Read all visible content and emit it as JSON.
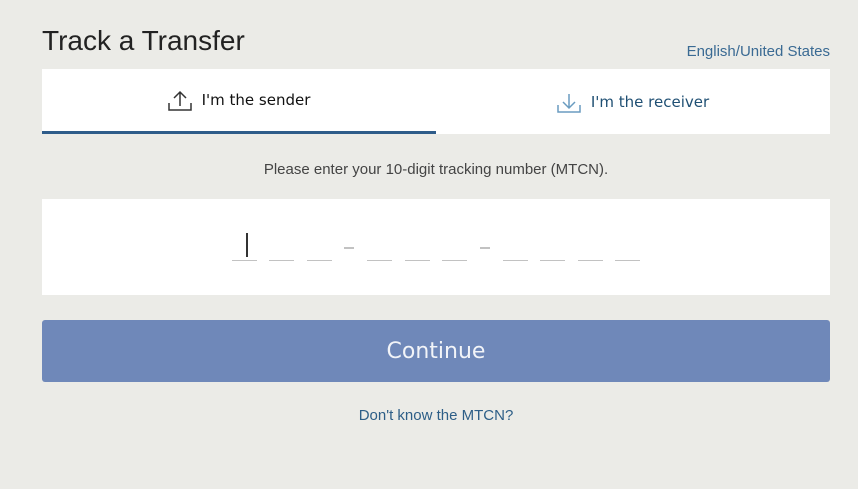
{
  "header": {
    "title": "Track a Transfer",
    "language_link": "English/United States"
  },
  "tabs": [
    {
      "label": "I'm the sender",
      "icon": "upload-icon",
      "active": true
    },
    {
      "label": "I'm the receiver",
      "icon": "download-icon",
      "active": false
    }
  ],
  "form": {
    "instruction": "Please enter your 10-digit tracking number (MTCN).",
    "mtcn_value": "",
    "digit_count": 10,
    "continue_label": "Continue",
    "help_link": "Don't know the MTCN?"
  },
  "colors": {
    "background": "#ebebe7",
    "accent": "#2e5c8a",
    "button": "#6f88b9",
    "link": "#3a6a93"
  }
}
